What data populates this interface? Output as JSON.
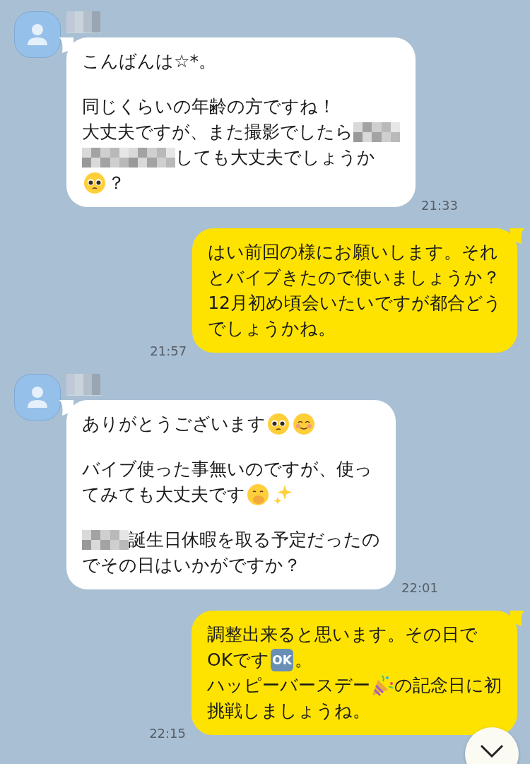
{
  "messages": [
    {
      "kind": "incoming",
      "time": "21:33",
      "paragraphs": [
        [
          [
            {
              "kind": "text",
              "text": "こんばんは☆*。"
            }
          ]
        ],
        [
          [
            {
              "kind": "text",
              "text": "同じくらいの年齢の方ですね！"
            }
          ],
          [
            {
              "kind": "text",
              "text": "大丈夫ですが、また撮影でしたら"
            },
            {
              "kind": "redacted"
            }
          ],
          [
            {
              "kind": "redacted"
            },
            {
              "kind": "redacted"
            },
            {
              "kind": "text",
              "text": "しても大丈夫でしょうか"
            }
          ],
          [
            {
              "kind": "pleading-face"
            },
            {
              "kind": "text",
              "text": "？"
            }
          ]
        ]
      ]
    },
    {
      "kind": "outgoing",
      "time": "21:57",
      "paragraphs": [
        [
          [
            {
              "kind": "text",
              "text": "はい前回の様にお願いします。それ"
            }
          ],
          [
            {
              "kind": "text",
              "text": "とバイブきたので使いましょうか？"
            }
          ],
          [
            {
              "kind": "text",
              "text": "12月初め頃会いたいですが都合どう"
            }
          ],
          [
            {
              "kind": "text",
              "text": "でしょうかね。"
            }
          ]
        ]
      ]
    },
    {
      "kind": "incoming",
      "time": "22:01",
      "paragraphs": [
        [
          [
            {
              "kind": "text",
              "text": "ありがとうございます"
            },
            {
              "kind": "pleading-face"
            },
            {
              "kind": "smiling-face"
            }
          ]
        ],
        [
          [
            {
              "kind": "text",
              "text": "バイブ使った事無いのですが、使っ"
            }
          ],
          [
            {
              "kind": "text",
              "text": "てみても大丈夫です"
            },
            {
              "kind": "hand-over-mouth"
            },
            {
              "kind": "sparkles"
            }
          ]
        ],
        [
          [
            {
              "kind": "redacted"
            },
            {
              "kind": "text",
              "text": "誕生日休暇を取る予定だったの"
            }
          ],
          [
            {
              "kind": "text",
              "text": "でその日はいかがですか？"
            }
          ]
        ]
      ]
    },
    {
      "kind": "outgoing",
      "time": "22:15",
      "paragraphs": [
        [
          [
            {
              "kind": "text",
              "text": "調整出来ると思います。その日で"
            }
          ],
          [
            {
              "kind": "text",
              "text": "OKです"
            },
            {
              "kind": "ok-button",
              "text": "OK"
            },
            {
              "kind": "text",
              "text": "。"
            }
          ],
          [
            {
              "kind": "text",
              "text": "ハッピーバースデー"
            },
            {
              "kind": "party-popper"
            },
            {
              "kind": "text",
              "text": "の記念日に初"
            }
          ],
          [
            {
              "kind": "text",
              "text": "挑戦しましょうね。"
            }
          ]
        ]
      ]
    }
  ],
  "scroll_to_bottom": true
}
